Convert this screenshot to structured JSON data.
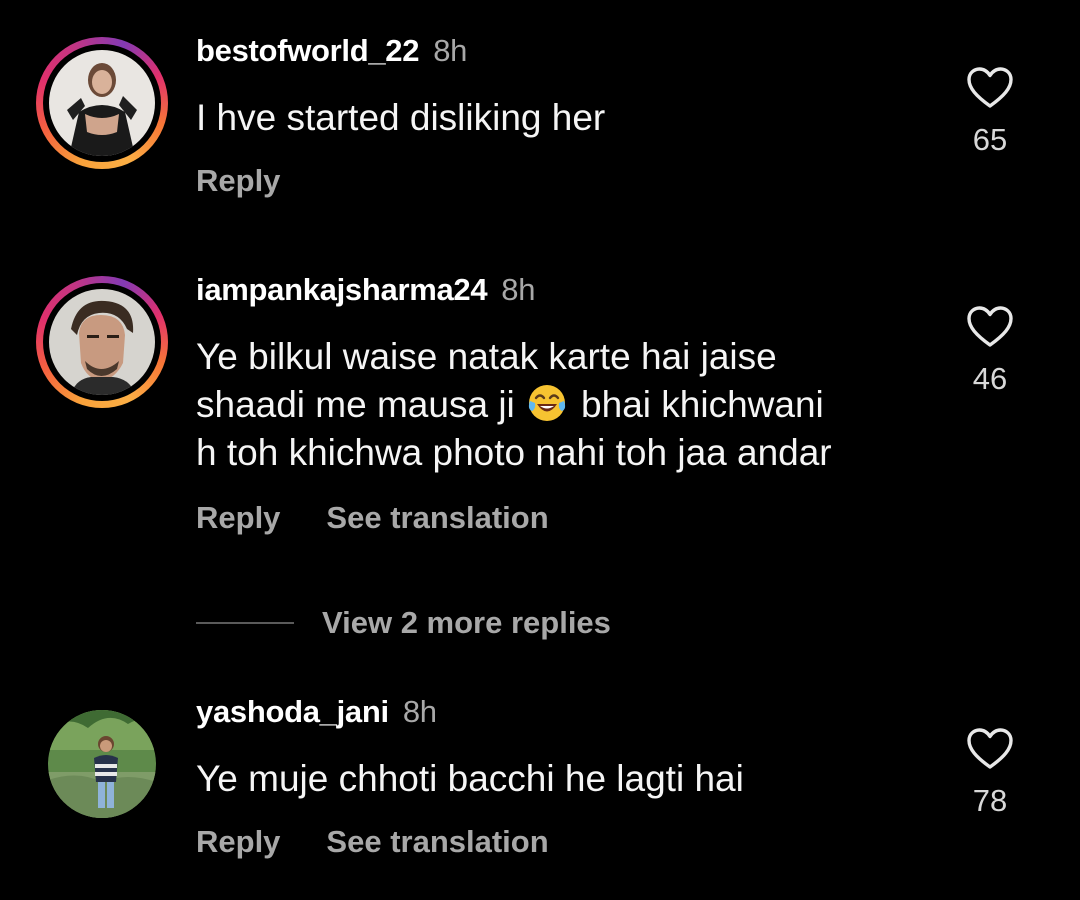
{
  "comments": [
    {
      "username": "bestofworld_22",
      "time": "8h",
      "text": "I hve started disliking her",
      "likes": "65",
      "reply_label": "Reply",
      "avatar": "profile-photo-woman",
      "story_ring": true
    },
    {
      "username": "iampankajsharma24",
      "time": "8h",
      "text_line1": "Ye bilkul waise natak karte hai jaise",
      "text_line2_a": "shaadi me mausa ji",
      "emoji": "face-with-tears-of-joy",
      "text_line2_b": "bhai khichwani",
      "text_line3": "h toh khichwa photo nahi toh jaa andar",
      "likes": "46",
      "reply_label": "Reply",
      "translation_label": "See translation",
      "avatar": "profile-photo-man",
      "story_ring": true
    },
    {
      "username": "yashoda_jani",
      "time": "8h",
      "text": "Ye muje chhoti bacchi he lagti hai",
      "likes": "78",
      "reply_label": "Reply",
      "translation_label": "See translation",
      "avatar": "profile-photo-woman-outdoors",
      "story_ring": false
    }
  ],
  "view_more_replies": "View 2 more replies",
  "colors": {
    "background": "#000000",
    "primary_text": "#f5f5f5",
    "secondary_text": "#a8a8a8",
    "story_ring": [
      "#fcaf45",
      "#f56040",
      "#e1306c",
      "#833ab4"
    ]
  }
}
